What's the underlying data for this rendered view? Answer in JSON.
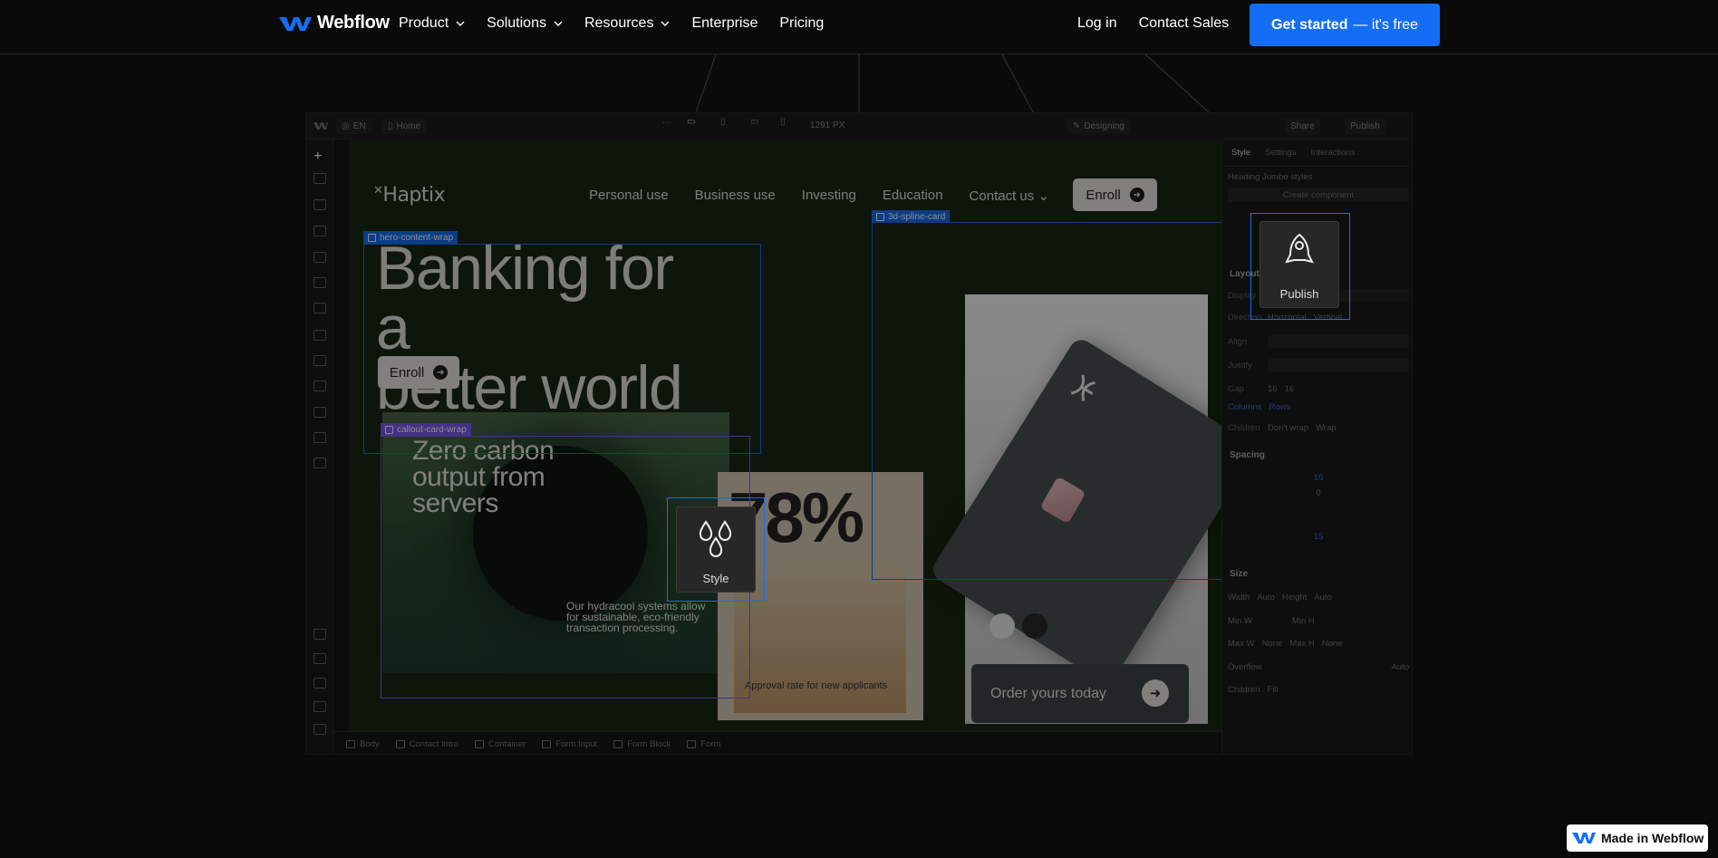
{
  "nav": {
    "brand": "Webflow",
    "links": [
      "Product",
      "Solutions",
      "Resources",
      "Enterprise",
      "Pricing"
    ],
    "login": "Log in",
    "contact": "Contact Sales",
    "cta_bold": "Get started",
    "cta_rest": "— it's free"
  },
  "editor": {
    "locale": "EN",
    "page": "Home",
    "width": "1291 PX",
    "mode": "Designing",
    "share": "Share",
    "publish": "Publish",
    "tabs": [
      "Style",
      "Settings",
      "Interactions"
    ],
    "heading_style": "Heading Jumbo styles",
    "create_component": "Create component",
    "layout": "Layout",
    "display": "Display",
    "direction": "Direction",
    "dir_h": "Horizontal",
    "dir_v": "Vertical",
    "align": "Align",
    "justify": "Justify",
    "gap": "Gap",
    "gap_val": "16",
    "columns": "Columns",
    "rows": "Rows",
    "children": "Children",
    "dont_wrap": "Don't wrap",
    "wrap": "Wrap",
    "spacing": "Spacing",
    "margin_top": "15",
    "padding_top": "0",
    "margin_bottom": "15",
    "size": "Size",
    "width_lbl": "Width",
    "height_lbl": "Height",
    "auto": "Auto",
    "min_w": "Min W",
    "min_h": "Min H",
    "max_w": "Max W",
    "max_h": "Max H",
    "none": "None",
    "overflow": "Overflow",
    "children2": "Children",
    "fill": "Fill",
    "breadcrumbs": [
      "Body",
      "Contact Intro",
      "Container",
      "Form Input",
      "Form Block",
      "Form"
    ],
    "sel_hero": "hero-content-wrap",
    "sel_callout": "callout-card-wrap",
    "sel_card": "3d-spline-card",
    "tooltip_style": "Style",
    "tooltip_publish": "Publish"
  },
  "site": {
    "logo": "Haptix",
    "links": [
      "Personal use",
      "Business use",
      "Investing",
      "Education",
      "Contact us"
    ],
    "enroll": "Enroll",
    "hero_line1": "Banking for a",
    "hero_line2": "better world",
    "callout_title_1": "Zero carbon",
    "callout_title_2": "output from",
    "callout_title_3": "servers",
    "callout_body": "Our hydracool systems allow for sustainable, eco-friendly transaction processing.",
    "stat": "78%",
    "stat_caption": "Approval rate for new applicants",
    "order_cta": "Order yours today"
  },
  "badge": "Made in Webflow",
  "colors": {
    "accent": "#146ef5",
    "selection_purple": "#7b5cf0",
    "canvas_bg": "#1a2814"
  }
}
